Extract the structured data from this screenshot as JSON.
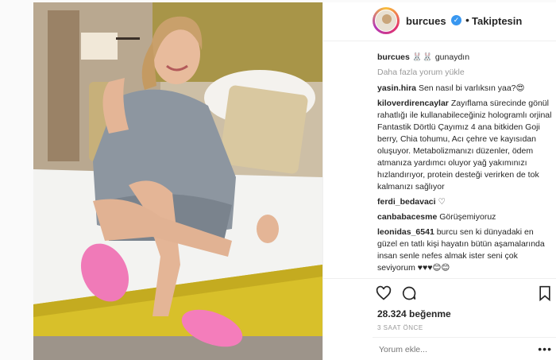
{
  "post": {
    "username": "burcues",
    "follow_status": "Takiptesin",
    "caption_user": "burcues",
    "caption_text": "🐰🐰 gunaydın",
    "load_more": "Daha fazla yorum yükle"
  },
  "comments": [
    {
      "user": "yasin.hira",
      "text": "Sen nasıl bi varlıksın yaa?😍"
    },
    {
      "user": "kiloverdirencaylar",
      "text": "Zayıflama sürecinde gönül rahatlığı ile kullanabileceğiniz hologramlı orjinal Fantastik Dörtlü Çayımız 4 ana bitkiden Goji berry, Chia tohumu, Acı çehre ve kayısıdan oluşuyor. Metabolizmanızı düzenler, ödem atmanıza yardımcı oluyor yağ yakımınızı hızlandırıyor, protein desteği verirken de tok kalmanızı sağlıyor"
    },
    {
      "user": "ferdi_bedavaci",
      "text": "♡"
    },
    {
      "user": "canbabacesme",
      "text": "Görüşemiyoruz"
    },
    {
      "user": "leonidas_6541",
      "text": "burcu sen ki dünyadaki en güzel en tatlı kişi hayatın bütün aşamalarında insan senle nefes almak ister seni çok seviyorum ♥♥♥😊😊"
    }
  ],
  "actions": {
    "likes": "28.324 beğenme",
    "time": "3 SAAT ÖNCE",
    "comment_placeholder": "Yorum ekle...",
    "more": "•••"
  },
  "icons": {
    "like": "heart-icon",
    "comment": "comment-bubble-icon",
    "save": "bookmark-icon",
    "verified": "verified-badge-icon"
  },
  "colors": {
    "verified_blue": "#3897f0",
    "muted_gray": "#999999",
    "text_dark": "#262626"
  }
}
